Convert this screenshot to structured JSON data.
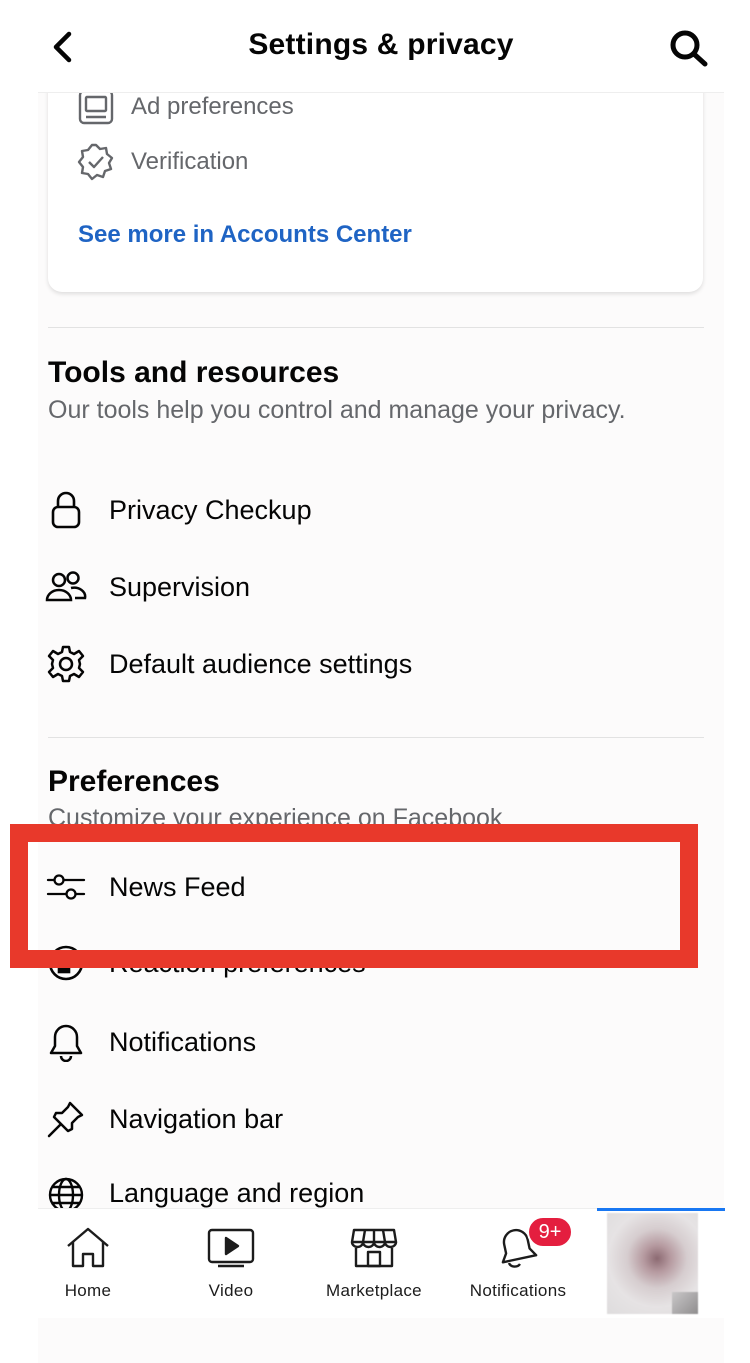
{
  "header": {
    "title": "Settings & privacy",
    "back_icon": "chevron-left-icon",
    "search_icon": "search-icon"
  },
  "accounts_card": {
    "items": [
      {
        "label": "Ad preferences",
        "icon": "ad-preferences-icon"
      },
      {
        "label": "Verification",
        "icon": "verification-badge-icon"
      }
    ],
    "link": "See more in Accounts Center"
  },
  "tools": {
    "title": "Tools and resources",
    "subtitle": "Our tools help you control and manage your privacy.",
    "items": [
      {
        "label": "Privacy Checkup",
        "icon": "lock-icon"
      },
      {
        "label": "Supervision",
        "icon": "people-icon"
      },
      {
        "label": "Default audience settings",
        "icon": "gear-icon"
      }
    ]
  },
  "preferences": {
    "title": "Preferences",
    "subtitle": "Customize your experience on Facebook",
    "items": [
      {
        "label": "News Feed",
        "icon": "sliders-icon"
      },
      {
        "label": "Reaction preferences",
        "icon": "reaction-icon"
      },
      {
        "label": "Notifications",
        "icon": "bell-icon"
      },
      {
        "label": "Navigation bar",
        "icon": "pin-icon"
      },
      {
        "label": "Language and region",
        "icon": "globe-icon"
      }
    ]
  },
  "bottom_nav": {
    "tabs": [
      {
        "label": "Home",
        "icon": "home-icon"
      },
      {
        "label": "Video",
        "icon": "video-icon"
      },
      {
        "label": "Marketplace",
        "icon": "marketplace-icon"
      },
      {
        "label": "Notifications",
        "icon": "bell-icon"
      }
    ],
    "notifications_badge": "9+",
    "profile_icon": "profile-avatar"
  },
  "colors": {
    "highlight": "#e8392b",
    "link": "#1f64c4",
    "badge": "#e41e3f",
    "active_indicator": "#1877f2"
  }
}
